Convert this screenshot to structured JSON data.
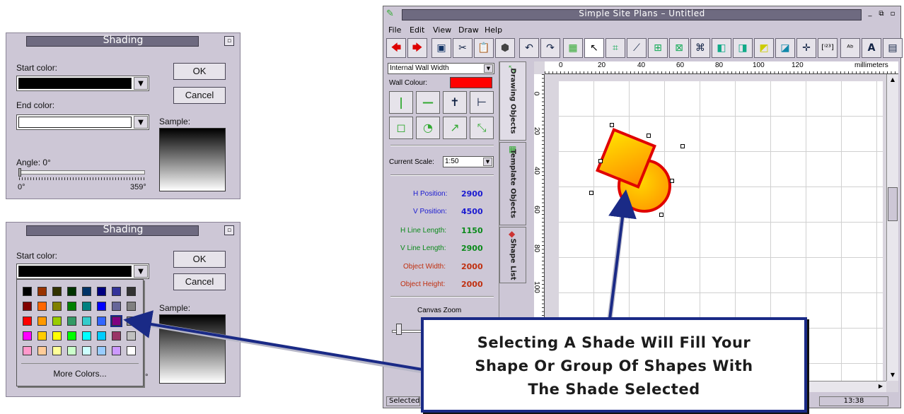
{
  "dialog_top": {
    "title": "Shading",
    "start_color_label": "Start color:",
    "end_color_label": "End color:",
    "ok": "OK",
    "cancel": "Cancel",
    "sample_label": "Sample:",
    "angle_label": "Angle: 0°",
    "angle_min": "0°",
    "angle_max": "359°",
    "start_color": "#000000",
    "end_color": "#ffffff",
    "angle_value": 0
  },
  "dialog_bottom": {
    "title": "Shading",
    "start_color_label": "Start color:",
    "ok": "OK",
    "cancel": "Cancel",
    "sample_label": "Sample:",
    "angle_tail": "9°",
    "more_colors": "More Colors...",
    "palette": [
      [
        "#000000",
        "#993300",
        "#333300",
        "#003300",
        "#003366",
        "#000080",
        "#333399",
        "#333333"
      ],
      [
        "#800000",
        "#ff6600",
        "#808000",
        "#008000",
        "#008080",
        "#0000ff",
        "#666699",
        "#808080"
      ],
      [
        "#ff0000",
        "#ff9900",
        "#99cc00",
        "#339966",
        "#33cccc",
        "#3366ff",
        "#800080",
        "#969696"
      ],
      [
        "#ff00ff",
        "#ffcc00",
        "#ffff00",
        "#00ff00",
        "#00ffff",
        "#00ccff",
        "#993366",
        "#c0c0c0"
      ],
      [
        "#ff99cc",
        "#ffcc99",
        "#ffff99",
        "#ccffcc",
        "#ccffff",
        "#99ccff",
        "#cc99ff",
        "#ffffff"
      ]
    ]
  },
  "app": {
    "title": "Simple Site Plans – Untitled",
    "menu": [
      "File",
      "Edit",
      "View",
      "Draw",
      "Help"
    ],
    "wall_type": "Internal Wall Width",
    "wall_colour_label": "Wall Colour:",
    "wall_colour": "#ff0000",
    "current_scale_label": "Current Scale:",
    "current_scale": "1:50",
    "h_position_label": "H Position:",
    "h_position": "2900",
    "v_position_label": "V Position:",
    "v_position": "4500",
    "h_line_length_label": "H Line Length:",
    "h_line_length": "1150",
    "v_line_length_label": "V Line Length:",
    "v_line_length": "2900",
    "object_width_label": "Object Width:",
    "object_width": "2000",
    "object_height_label": "Object Height:",
    "object_height": "2000",
    "canvas_zoom_label": "Canvas Zoom",
    "tabs": [
      "Drawing Objects",
      "Template Objects",
      "Shape List"
    ],
    "ruler_h": [
      "0",
      "20",
      "40",
      "60",
      "80",
      "100",
      "120",
      "millimeters"
    ],
    "ruler_v": [
      "0",
      "20",
      "40",
      "60",
      "80",
      "100"
    ],
    "status_left": "Selected",
    "status_time": "13:38"
  },
  "callout": {
    "line1": "Selecting A Shade Will Fill Your",
    "line2": "Shape Or Group Of Shapes With",
    "line3": "The Shade Selected"
  }
}
